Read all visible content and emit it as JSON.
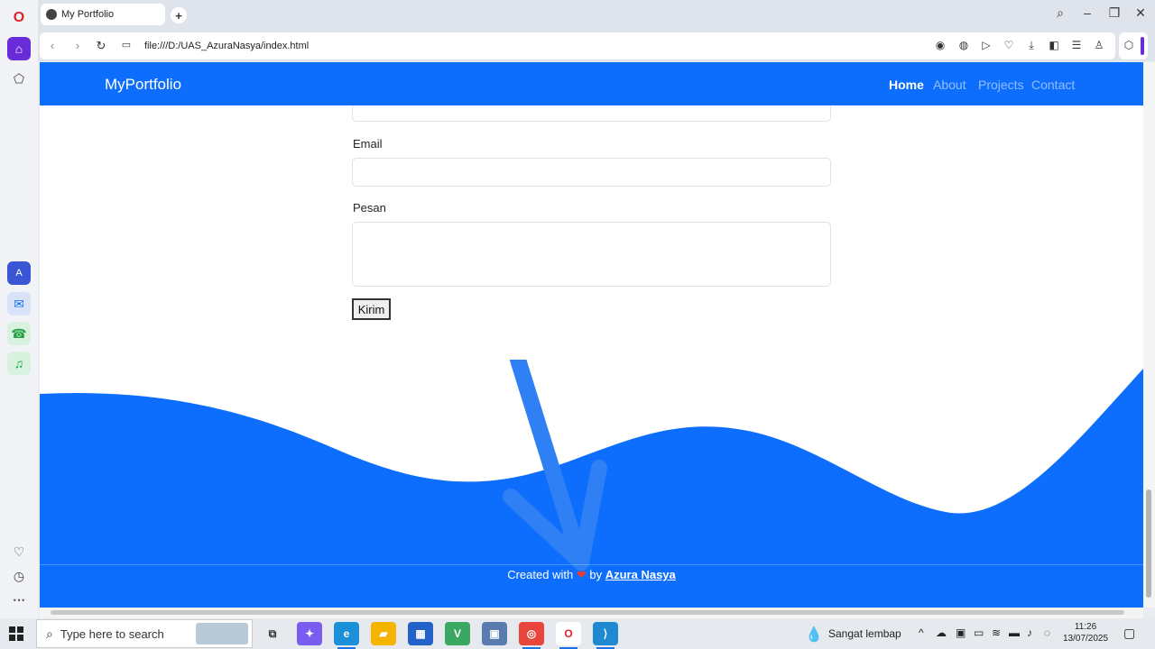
{
  "browser": {
    "tab_title": "My Portfolio",
    "url": "file:///D:/UAS_AzuraNasya/index.html",
    "accent": "#0d6efd"
  },
  "page": {
    "brand": "MyPortfolio",
    "nav": [
      {
        "label": "Home",
        "active": true
      },
      {
        "label": "About",
        "active": false
      },
      {
        "label": "Projects",
        "active": false
      },
      {
        "label": "Contact",
        "active": false
      }
    ],
    "form": {
      "email_label": "Email",
      "email_value": "",
      "message_label": "Pesan",
      "message_value": "",
      "submit_label": "Kirim"
    },
    "footer": {
      "prefix": "Created with",
      "by": "by",
      "author": "Azura Nasya"
    }
  },
  "taskbar": {
    "search_placeholder": "Type here to search",
    "weather": "Sangat lembap",
    "time": "11:26",
    "date": "13/07/2025"
  }
}
